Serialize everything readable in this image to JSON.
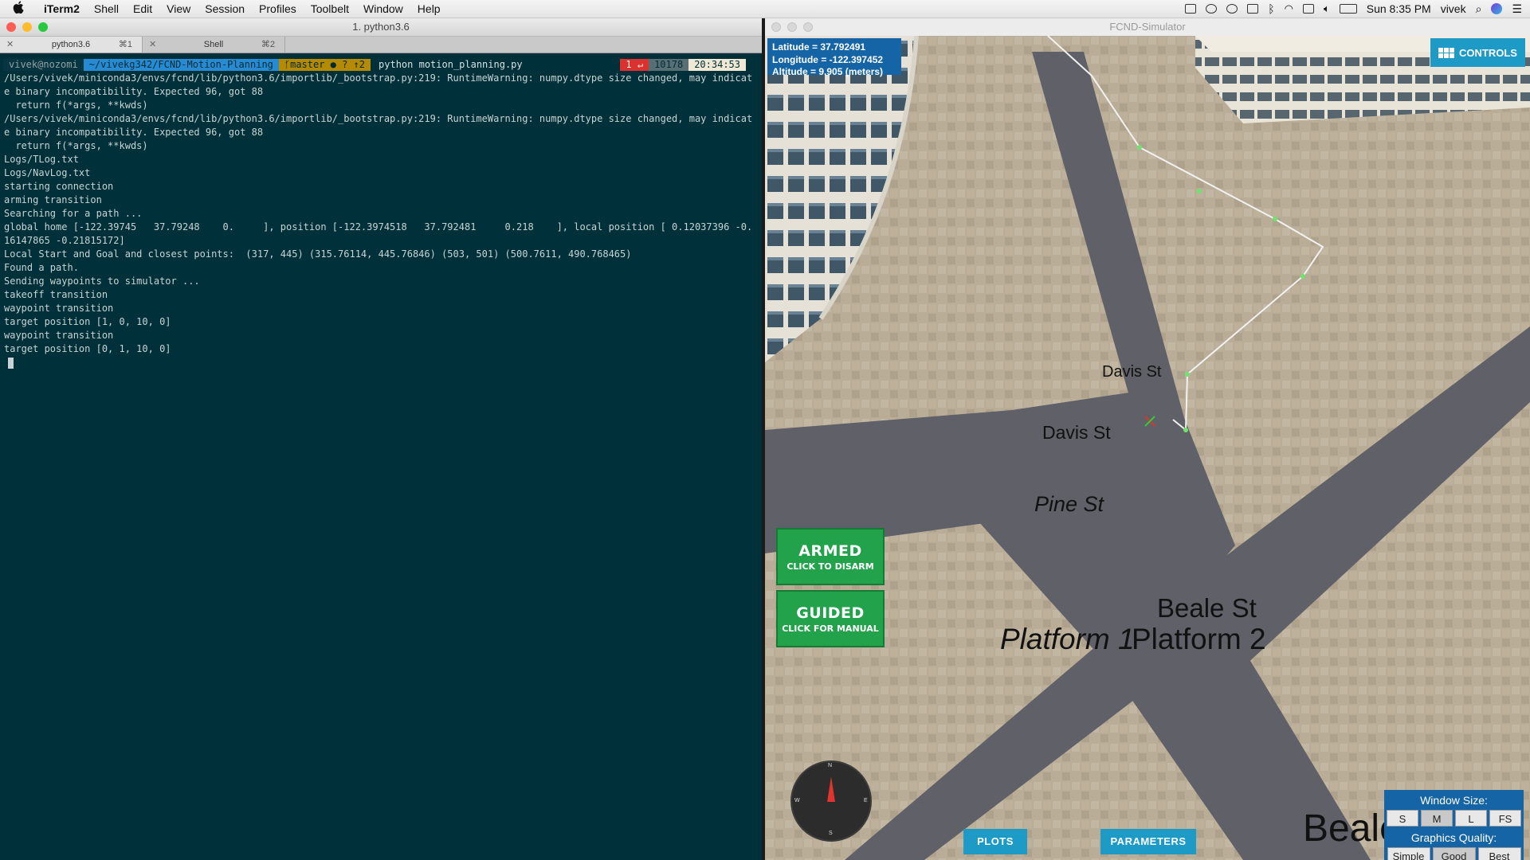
{
  "menubar": {
    "apple": "",
    "items": [
      "iTerm2",
      "Shell",
      "Edit",
      "View",
      "Session",
      "Profiles",
      "Toolbelt",
      "Window",
      "Help"
    ],
    "clock": "Sun 8:35 PM",
    "user": "vivek"
  },
  "terminal": {
    "window_title": "1. python3.6",
    "tabs": [
      {
        "label": "python3.6",
        "shortcut": "⌘1"
      },
      {
        "label": "Shell",
        "shortcut": "⌘2"
      }
    ],
    "prompt": {
      "user_host": "vivek@nozomi",
      "path": "~/vivekg342/FCND-Motion-Planning",
      "branch": "ᚶmaster ● ? ↑2",
      "command": "python motion_planning.py",
      "status": "1 ↵",
      "history": "10178",
      "time": "20:34:53"
    },
    "output": [
      "/Users/vivek/miniconda3/envs/fcnd/lib/python3.6/importlib/_bootstrap.py:219: RuntimeWarning: numpy.dtype size changed, may indicate binary incompatibility. Expected 96, got 88",
      "  return f(*args, **kwds)",
      "/Users/vivek/miniconda3/envs/fcnd/lib/python3.6/importlib/_bootstrap.py:219: RuntimeWarning: numpy.dtype size changed, may indicate binary incompatibility. Expected 96, got 88",
      "  return f(*args, **kwds)",
      "Logs/TLog.txt",
      "Logs/NavLog.txt",
      "starting connection",
      "arming transition",
      "Searching for a path ...",
      "global home [-122.39745   37.79248    0.     ], position [-122.3974518   37.792481     0.218    ], local position [ 0.12037396 -0.16147865 -0.21815172]",
      "Local Start and Goal and closest points:  (317, 445) (315.76114, 445.76846) (503, 501) (500.7611, 490.768465)",
      "Found a path.",
      "Sending waypoints to simulator ...",
      "takeoff transition",
      "waypoint transition",
      "target position [1, 0, 10, 0]",
      "waypoint transition",
      "target position [0, 1, 10, 0]"
    ]
  },
  "simulator": {
    "window_title": "FCND-Simulator",
    "telemetry": {
      "latitude": "Latitude = 37.792491",
      "longitude": "Longitude = -122.397452",
      "altitude": "Altitude = 9.905 (meters)"
    },
    "controls_label": "CONTROLS",
    "armed": {
      "main": "ARMED",
      "sub": "CLICK TO DISARM"
    },
    "guided": {
      "main": "GUIDED",
      "sub": "CLICK FOR MANUAL"
    },
    "plots_label": "PLOTS",
    "parameters_label": "PARAMETERS",
    "compass": {
      "n": "N",
      "s": "S",
      "e": "E",
      "w": "W"
    },
    "streets": [
      "Davis St",
      "Davis St",
      "Pine St",
      "Beale St",
      "Platform 1",
      "Platform 2",
      "Beale"
    ],
    "window_size": {
      "title": "Window Size:",
      "options": [
        "S",
        "M",
        "L",
        "FS"
      ],
      "selected": "M"
    },
    "graphics_quality": {
      "title": "Graphics Quality:",
      "options": [
        "Simple",
        "Good",
        "Best"
      ],
      "selected": "Good"
    }
  },
  "colors": {
    "terminal_bg": "#00313a",
    "armed_green": "#22a24a",
    "hud_blue": "#1565a6",
    "button_blue": "#1e9ac7",
    "road": "#5f6068",
    "pavement": "#b7ab95"
  }
}
